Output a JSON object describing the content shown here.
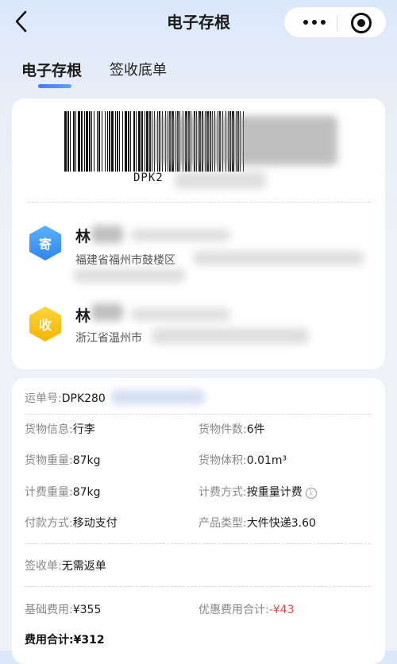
{
  "nav": {
    "title": "电子存根"
  },
  "tabs": [
    {
      "label": "电子存根",
      "active": true
    },
    {
      "label": "签收底单",
      "active": false
    }
  ],
  "stub": {
    "waybill_code_visible": "DPK2",
    "sender": {
      "badge": "寄",
      "name_visible": "林",
      "address_visible": "福建省福州市鼓楼区"
    },
    "receiver": {
      "badge": "收",
      "name_visible": "林",
      "address_visible": "浙江省温州市"
    }
  },
  "details": {
    "waybill": {
      "label": "运单号:",
      "value_visible": "DPK280"
    },
    "cargo_info": {
      "label": "货物信息:",
      "value": "行李"
    },
    "cargo_count": {
      "label": "货物件数:",
      "value": "6件"
    },
    "cargo_weight": {
      "label": "货物重量:",
      "value": "87kg"
    },
    "cargo_volume": {
      "label": "货物体积:",
      "value": "0.01m³"
    },
    "billing_weight": {
      "label": "计费重量:",
      "value": "87kg"
    },
    "billing_method": {
      "label": "计费方式:",
      "value": "按重量计费",
      "info_icon": "i"
    },
    "payment_method": {
      "label": "付款方式:",
      "value": "移动支付"
    },
    "product_type": {
      "label": "产品类型:",
      "value": "大件快递3.60"
    },
    "receipt": {
      "label": "签收单:",
      "value": "无需返单"
    },
    "base_fee": {
      "label": "基础费用:",
      "value": "¥355"
    },
    "discount_total": {
      "label": "优惠费用合计:",
      "value": "-¥43"
    },
    "total": {
      "label": "费用合计:",
      "value": "¥312"
    }
  },
  "colors": {
    "accent": "#3b7dff",
    "send_badge": "#2f86f5",
    "recv_badge": "#f6b400",
    "discount": "#e04a3f"
  }
}
